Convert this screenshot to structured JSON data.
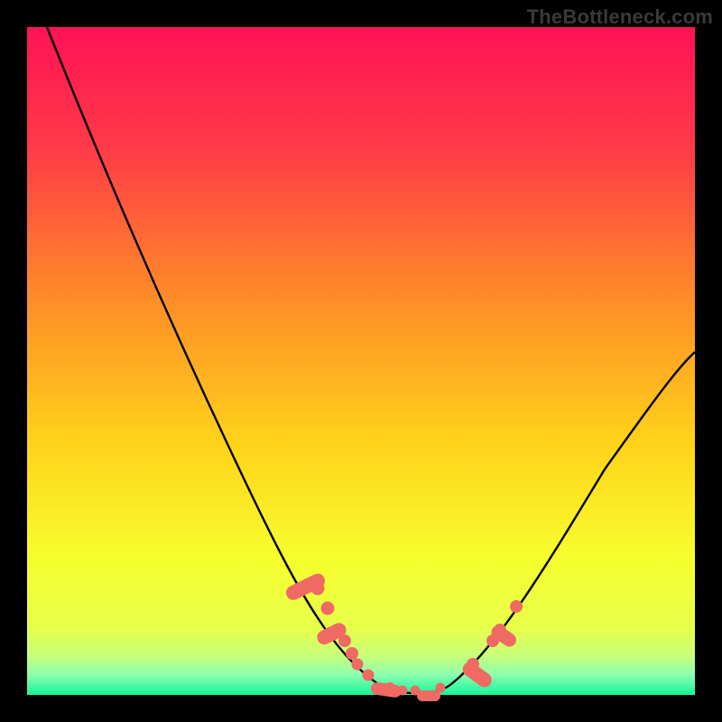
{
  "watermark": "TheBottleneck.com",
  "colors": {
    "marker": "#ee6a63",
    "curve": "#000000",
    "grad_top": "#ff1255",
    "grad_mid1": "#ff7a2a",
    "grad_mid2": "#ffd21a",
    "grad_mid3": "#f1ff30",
    "grad_bottom_band": "#bfff7a",
    "grad_bottom": "#14f59a"
  },
  "chart_data": {
    "type": "line",
    "title": "",
    "xlabel": "",
    "ylabel": "",
    "xlim": [
      0,
      100
    ],
    "ylim": [
      0,
      100
    ],
    "x": [
      3,
      6,
      10,
      14,
      18,
      22,
      26,
      30,
      34,
      38,
      42,
      46,
      50,
      53,
      57,
      60,
      64,
      68,
      72,
      76,
      80,
      84,
      88,
      92,
      96,
      100
    ],
    "values": [
      100,
      93,
      85,
      77,
      69,
      61,
      53,
      45,
      37,
      29,
      21,
      13,
      6,
      2,
      0,
      0,
      2,
      6,
      12,
      19,
      26,
      32,
      37,
      41,
      44,
      46
    ],
    "annotations": [
      {
        "type": "marker-cluster",
        "x_range": [
          42,
          48
        ],
        "y_range": [
          4,
          18
        ]
      },
      {
        "type": "marker-cluster",
        "x_range": [
          49,
          60
        ],
        "y_range": [
          0,
          3
        ]
      },
      {
        "type": "marker-cluster",
        "x_range": [
          65,
          72
        ],
        "y_range": [
          5,
          15
        ]
      }
    ]
  }
}
